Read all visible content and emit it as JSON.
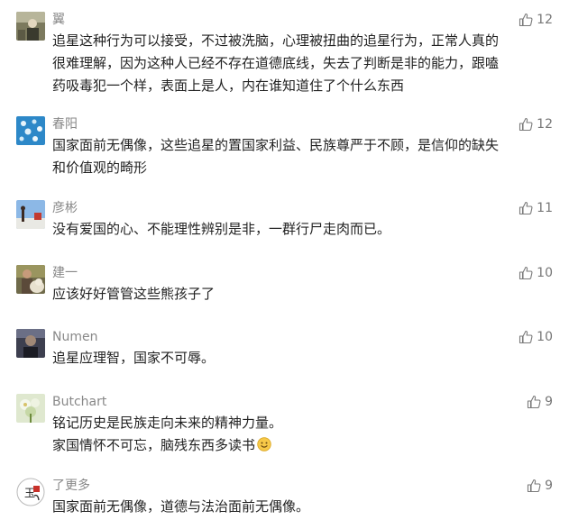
{
  "comments": [
    {
      "author": "翼",
      "likes": "12",
      "lines": [
        "追星这种行为可以接受，不过被洗脑，心理被扭曲的追星行为，正常人真的",
        "很难理解，因为这种人已经不存在道德底线，失去了判断是非的能力，跟嗑",
        "药吸毒犯一个样，表面上是人，内在谁知道住了个什么东西"
      ],
      "avatar_icon": "person-photo-avatar"
    },
    {
      "author": "春阳",
      "likes": "12",
      "lines": [
        "国家面前无偶像，这些追星的置国家利益、民族尊严于不顾，是信仰的缺失",
        "和价值观的畸形"
      ],
      "avatar_icon": "blue-pattern-avatar"
    },
    {
      "author": "彦彬",
      "likes": "11",
      "lines": [
        "没有爱国的心、不能理性辨别是非，一群行尸走肉而已。"
      ],
      "avatar_icon": "sky-scene-avatar"
    },
    {
      "author": "建一",
      "likes": "10",
      "lines": [
        "应该好好管管这些熊孩子了"
      ],
      "avatar_icon": "person-with-dog-avatar"
    },
    {
      "author": "Numen",
      "likes": "10",
      "lines": [
        "追星应理智，国家不可辱。"
      ],
      "avatar_icon": "dark-portrait-avatar"
    },
    {
      "author": "Butchart",
      "likes": "9",
      "lines": [
        "铭记历史是民族走向未来的精神力量。",
        "家国情怀不可忘，脑残东西多读书"
      ],
      "has_emoji": true,
      "emoji_icon": "smiley-emoji-icon",
      "avatar_icon": "flower-avatar"
    },
    {
      "author": "了更多",
      "likes": "9",
      "lines": [
        "国家面前无偶像，道德与法治面前无偶像。"
      ],
      "avatar_icon": "calligraphy-seal-avatar"
    }
  ],
  "like_icon": "thumbs-up-icon",
  "colors": {
    "name": "#888888",
    "text": "#222222",
    "like": "#777777",
    "background": "#ffffff"
  }
}
